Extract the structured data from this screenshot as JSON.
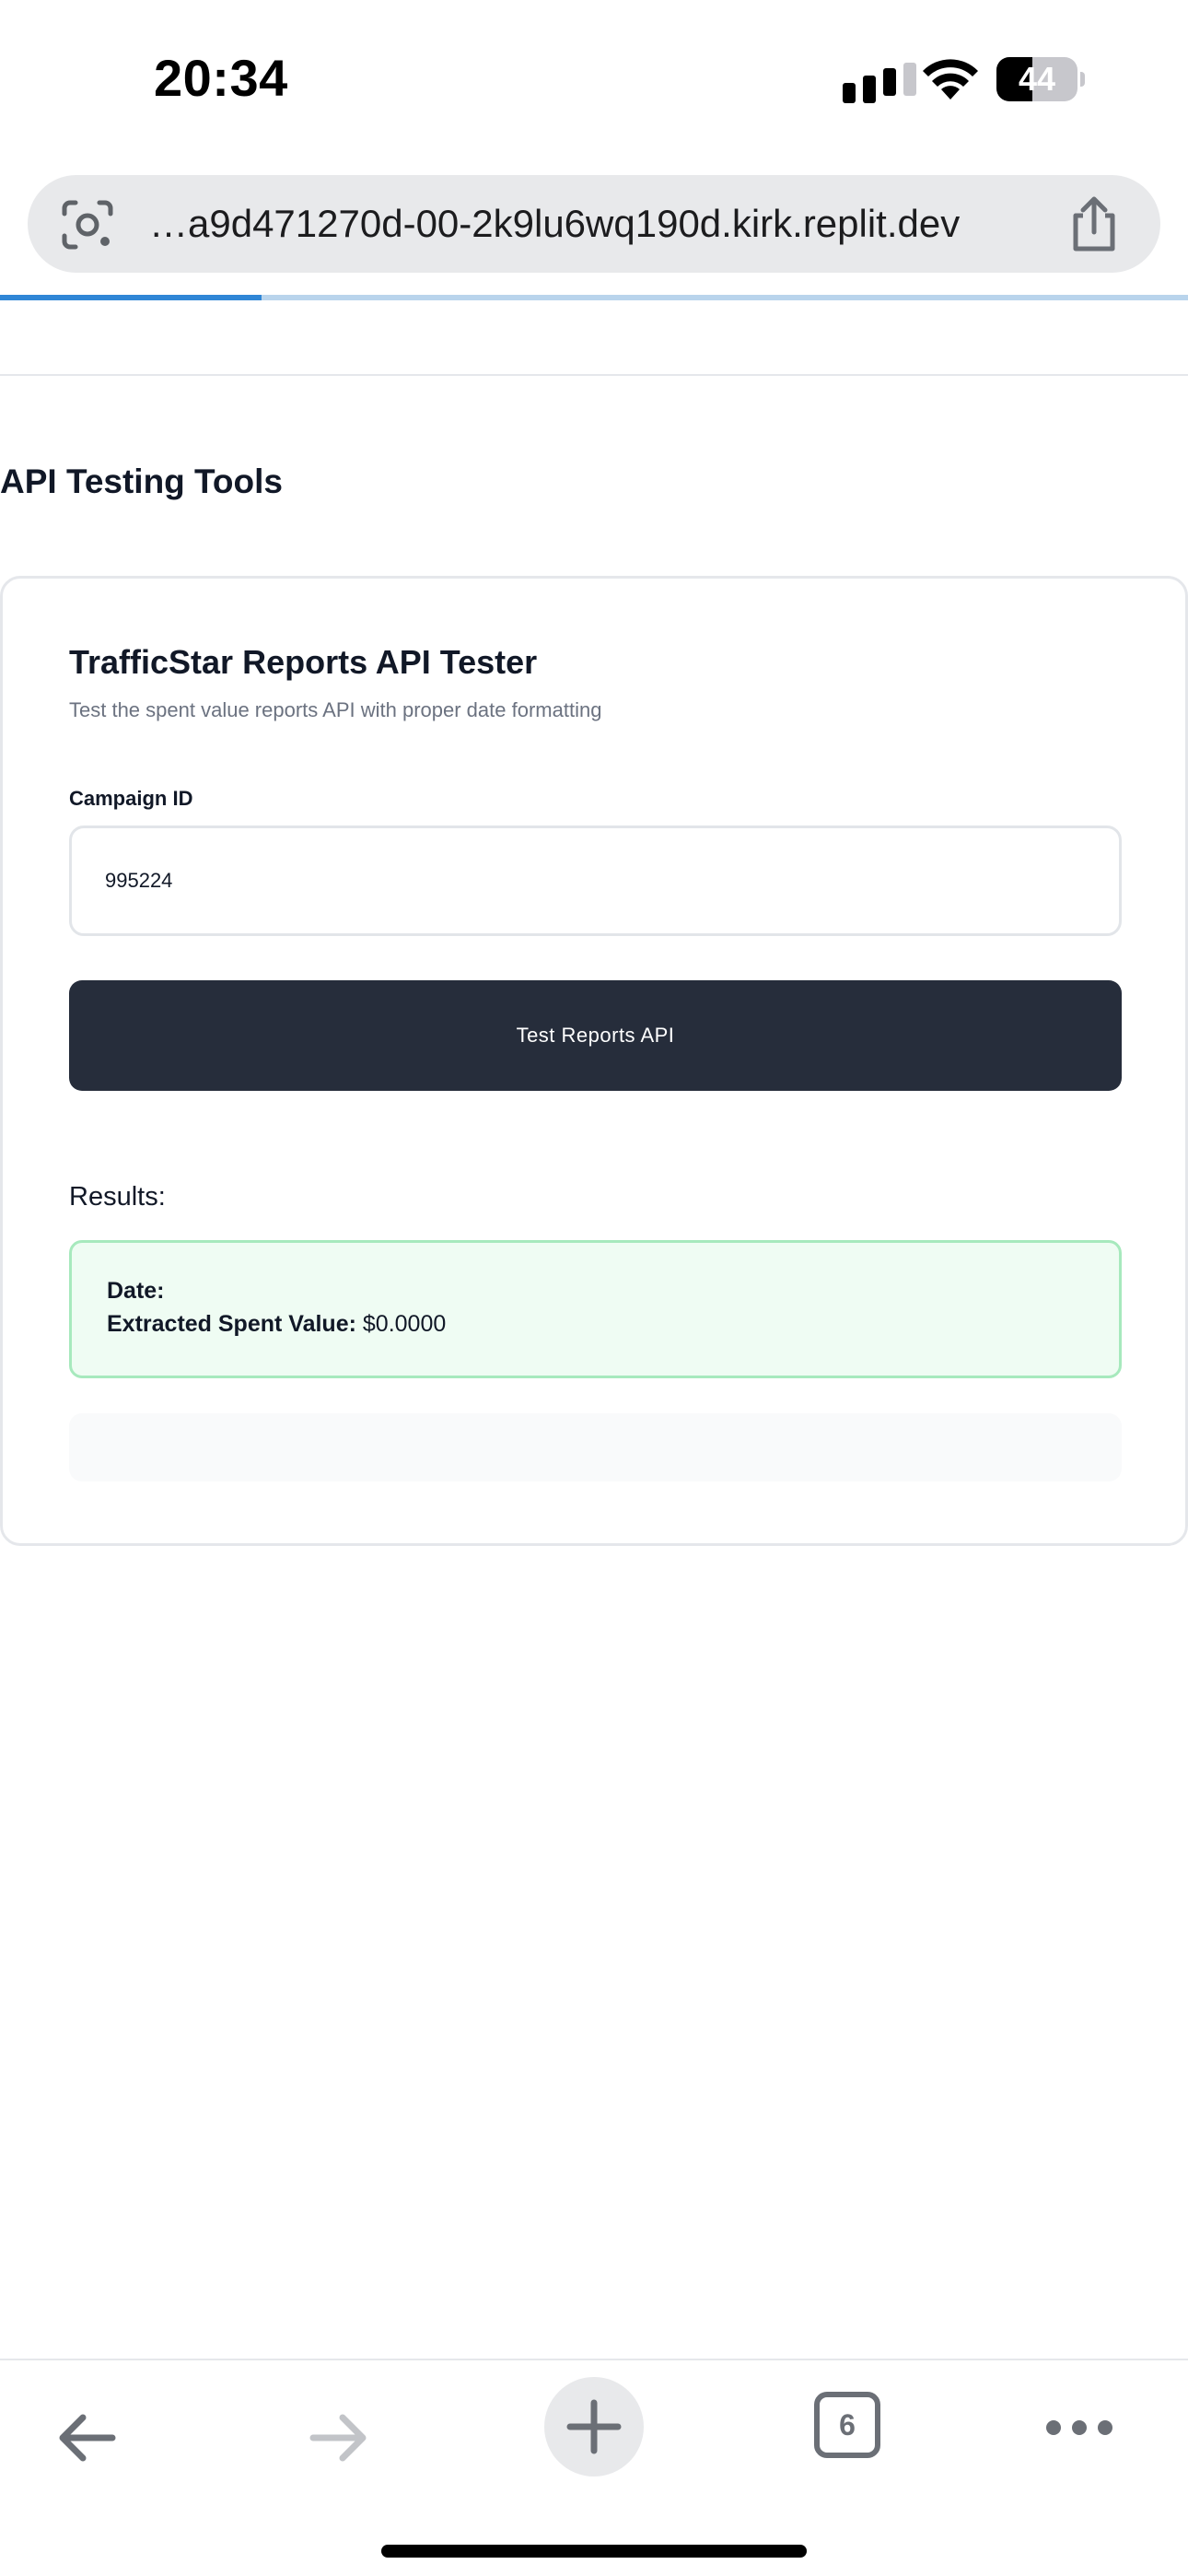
{
  "status_bar": {
    "time": "20:34",
    "battery_level": "44",
    "battery_fraction": 0.44
  },
  "browser": {
    "url": "…a9d471270d-00-2k9lu6wq190d.kirk.replit.dev",
    "load_progress": 0.22,
    "tab_count": "6"
  },
  "page": {
    "section_title": "API Testing Tools",
    "card": {
      "title": "TrafficStar Reports API Tester",
      "description": "Test the spent value reports API with proper date formatting",
      "campaign_label": "Campaign ID",
      "campaign_value": "995224",
      "submit_label": "Test Reports API",
      "results_label": "Results:",
      "result": {
        "date_label": "Date:",
        "date_value": "",
        "spent_label": "Extracted Spent Value:",
        "spent_value": "$0.0000"
      }
    }
  },
  "icons": {
    "lens": "lens-icon",
    "share": "share-icon",
    "back": "back-arrow-icon",
    "forward": "forward-arrow-icon",
    "new_tab": "plus-icon",
    "more": "more-icon"
  },
  "colors": {
    "accent_progress": "#2f86d6",
    "button_bg": "#262d3b",
    "success_bg": "#effcf3",
    "success_border": "#a7e9bd"
  }
}
